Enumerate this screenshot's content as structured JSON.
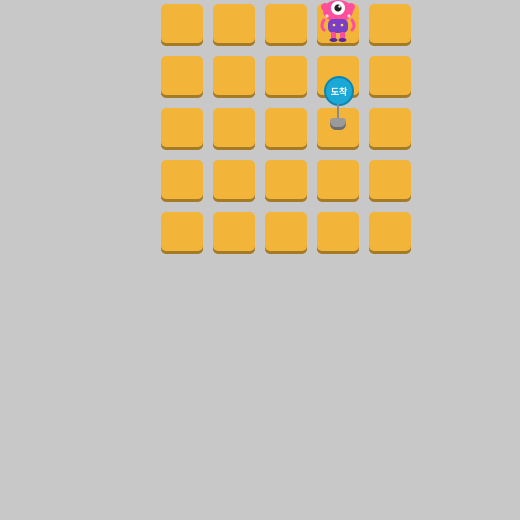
{
  "board": {
    "rows": 5,
    "cols": 5,
    "tile_color": "#f2b53a",
    "tile_shadow_color": "#a57a26"
  },
  "goal": {
    "label": "도착",
    "row": 2,
    "col": 4,
    "sign_color": "#1ba8d6"
  },
  "character": {
    "name": "pink-one-eyed-monster",
    "row": 1,
    "col": 4,
    "body_color": "#ff4f9a",
    "outfit_color": "#7b3fc6"
  },
  "background_color": "#c8c8c8"
}
